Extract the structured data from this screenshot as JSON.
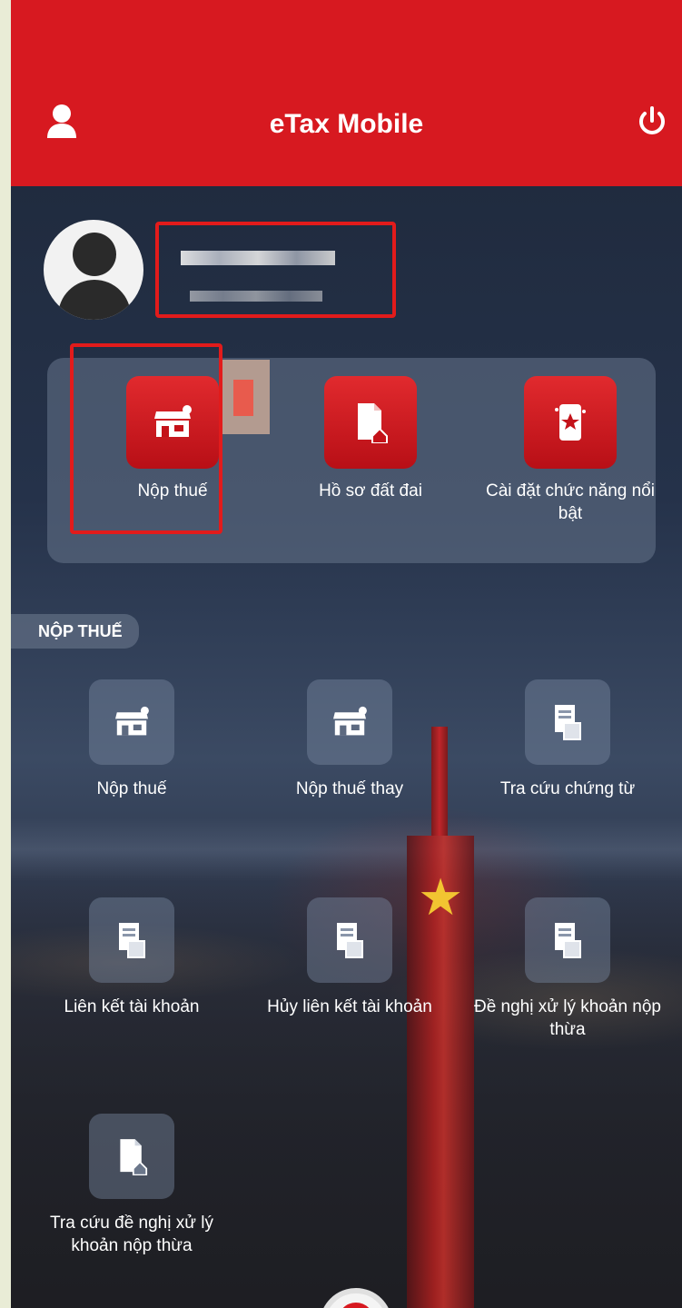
{
  "app": {
    "title": "eTax Mobile",
    "brand_color": "#d71920"
  },
  "header": {
    "user_icon": "user-icon",
    "power_icon": "power-icon"
  },
  "profile": {
    "name": "",
    "tax_id": "",
    "redacted": true
  },
  "quick_actions": [
    {
      "label": "Nộp thuế",
      "icon": "storefront-icon"
    },
    {
      "label": "Hồ sơ đất đai",
      "icon": "document-house-icon"
    },
    {
      "label": "Cài đặt chức năng nổi bật",
      "icon": "phone-star-icon"
    }
  ],
  "section": {
    "label": "NỘP THUẾ"
  },
  "grid": [
    {
      "label": "Nộp thuế",
      "icon": "storefront-icon"
    },
    {
      "label": "Nộp thuế thay",
      "icon": "storefront-icon"
    },
    {
      "label": "Tra cứu chứng từ",
      "icon": "document-stack-icon"
    },
    {
      "label": "Liên kết tài khoản",
      "icon": "document-stack-icon"
    },
    {
      "label": "Hủy liên kết tài khoản",
      "icon": "document-stack-icon"
    },
    {
      "label": "Đề nghị xử lý khoản nộp thừa",
      "icon": "document-stack-icon"
    },
    {
      "label": "Tra cứu đề nghị xử lý khoản nộp thừa",
      "icon": "document-house-icon"
    }
  ]
}
